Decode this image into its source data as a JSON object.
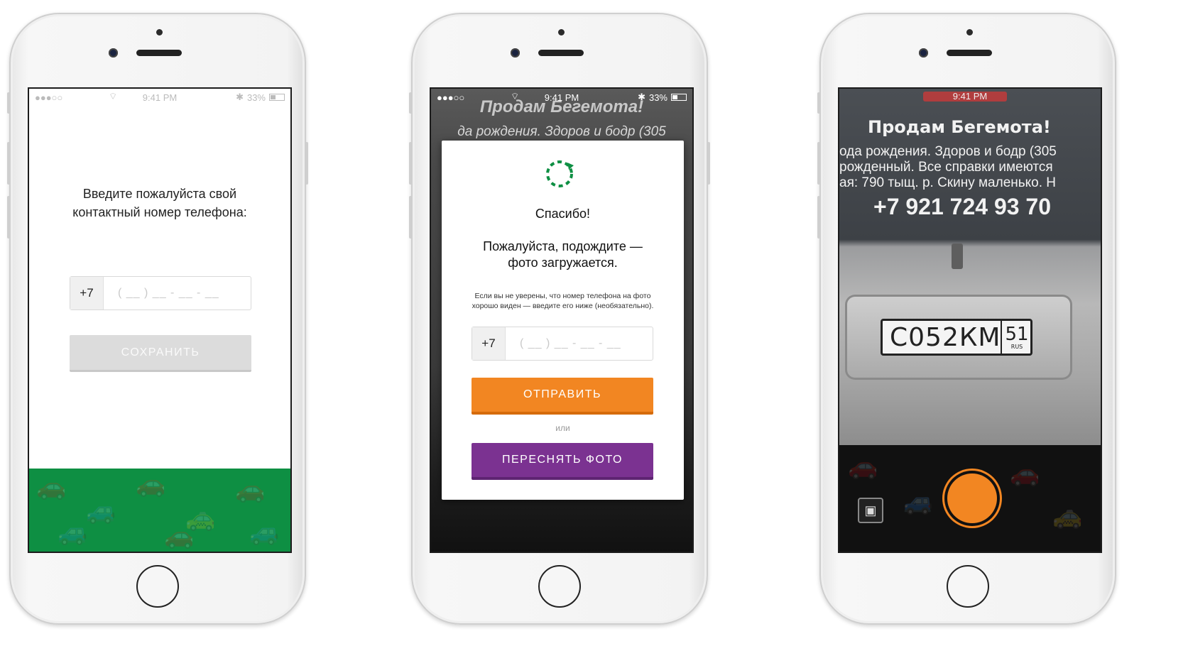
{
  "colors": {
    "green": "#0e8f43",
    "orange": "#f28622",
    "purple": "#7b3291",
    "disabled": "#dcdcdc"
  },
  "status_bar": {
    "signal": "●●●○○",
    "wifi": "wifi-icon",
    "time": "9:41 PM",
    "bluetooth": "bluetooth-icon",
    "battery": "33%"
  },
  "screen1": {
    "title": "Введите пожалуйста свой контактный номер телефона:",
    "prefix": "+7",
    "placeholder": "( __ ) __ - __ - __",
    "save_label": "СОХРАНИТЬ"
  },
  "screen2": {
    "bg_line1": "Продам Бегемота!",
    "bg_line2": "да рождения. Здоров и бодр (305",
    "thanks": "Спасибо!",
    "wait_line1": "Пожалуйста, подождите —",
    "wait_line2": "фото загружается.",
    "hint_line1": "Если вы не уверены, что номер телефона на фото",
    "hint_line2": "хорошо виден — введите его ниже (необязательно).",
    "prefix": "+7",
    "placeholder": "( __ ) __ - __ - __",
    "send_label": "ОТПРАВИТЬ",
    "or_label": "или",
    "retake_label": "ПЕРЕСНЯТЬ ФОТО"
  },
  "screen3": {
    "time": "9:41 PM",
    "ad_title": "Продам Бегемота!",
    "ad_line1": "ода рождения. Здоров и бодр (305",
    "ad_line2": "рожденный. Все справки имеются",
    "ad_line3": "ая: 790 тыщ. р. Скину маленько. Н",
    "ad_phone": "+7 921 724 93 70",
    "plate_number": "С052КМ",
    "plate_region": "51",
    "plate_country": "RUS"
  }
}
